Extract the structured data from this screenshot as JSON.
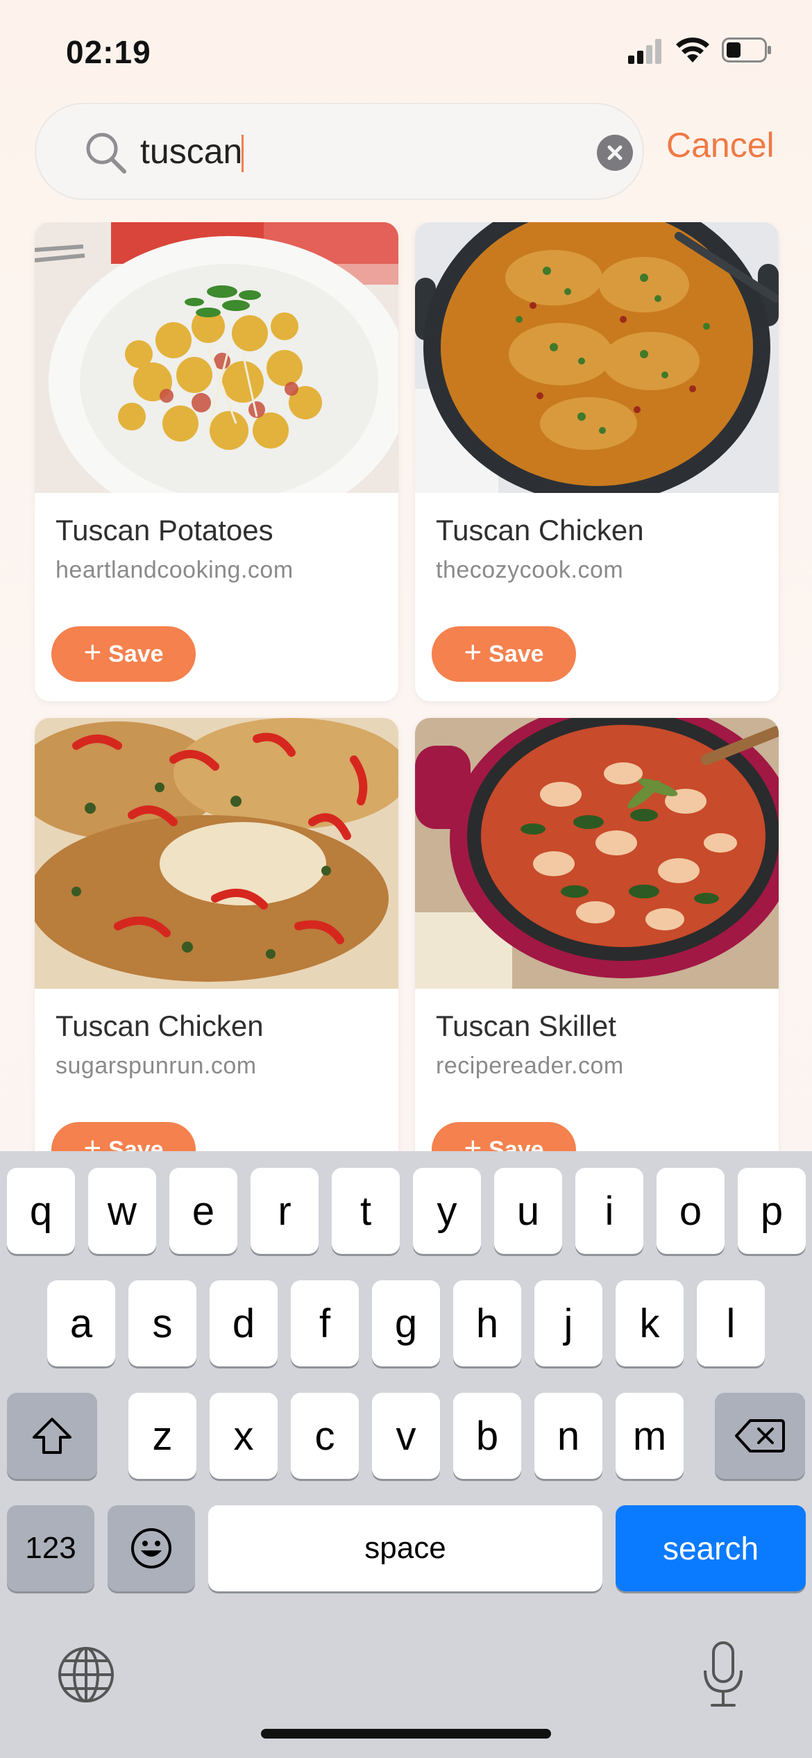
{
  "status_bar": {
    "time": "02:19"
  },
  "search": {
    "query": "tuscan",
    "cancel_label": "Cancel"
  },
  "cards": [
    {
      "title": "Tuscan Potatoes",
      "source": "heartlandcooking.com",
      "save_label": "Save"
    },
    {
      "title": "Tuscan Chicken",
      "source": "thecozycook.com",
      "save_label": "Save"
    },
    {
      "title": "Tuscan Chicken",
      "source": "sugarspunrun.com",
      "save_label": "Save"
    },
    {
      "title": "Tuscan Skillet",
      "source": "recipereader.com",
      "save_label": "Save"
    }
  ],
  "keyboard": {
    "row1": [
      "q",
      "w",
      "e",
      "r",
      "t",
      "y",
      "u",
      "i",
      "o",
      "p"
    ],
    "row2": [
      "a",
      "s",
      "d",
      "f",
      "g",
      "h",
      "j",
      "k",
      "l"
    ],
    "row3": [
      "z",
      "x",
      "c",
      "v",
      "b",
      "n",
      "m"
    ],
    "numbers_label": "123",
    "space_label": "space",
    "search_label": "search"
  },
  "colors": {
    "accent": "#f4814e",
    "cancel": "#ef7a45",
    "keyboard_action": "#0a7aff"
  }
}
